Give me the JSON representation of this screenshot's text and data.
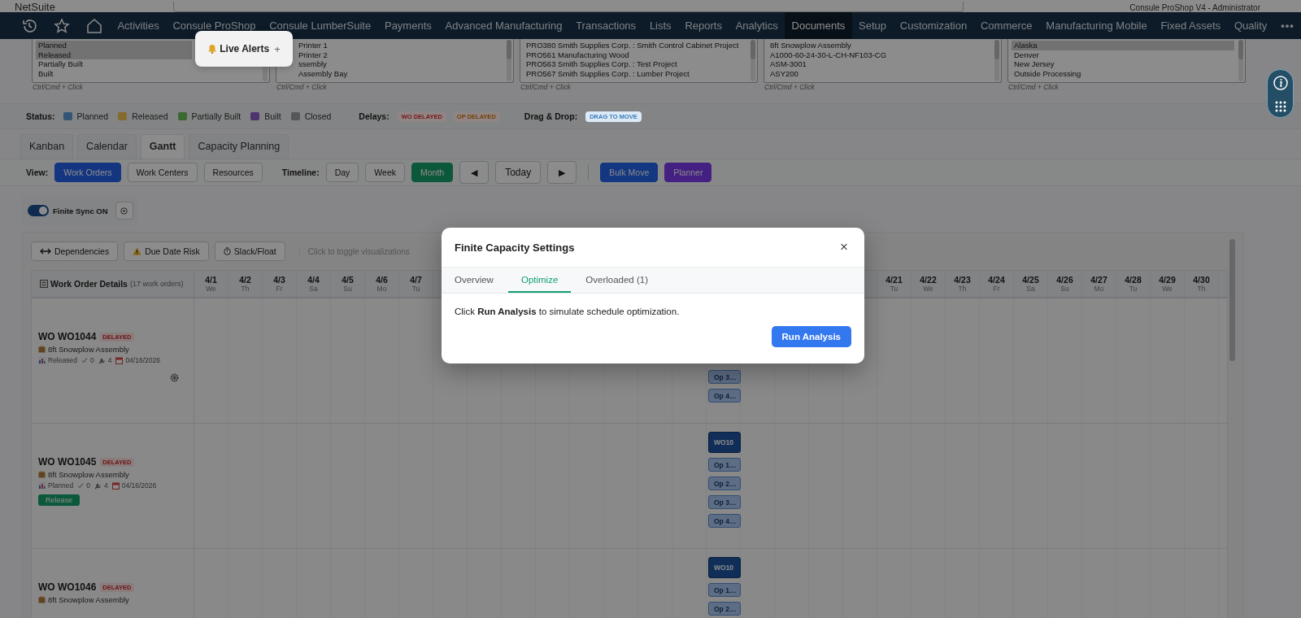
{
  "app": {
    "logo": "NetSuite",
    "user": "Consule ProShop V4 - Administrator"
  },
  "nav": {
    "items": [
      {
        "label": "Activities",
        "selected": false
      },
      {
        "label": "Consule ProShop",
        "selected": false
      },
      {
        "label": "Consule LumberSuite",
        "selected": false
      },
      {
        "label": "Payments",
        "selected": false
      },
      {
        "label": "Advanced Manufacturing",
        "selected": false
      },
      {
        "label": "Transactions",
        "selected": false
      },
      {
        "label": "Lists",
        "selected": false
      },
      {
        "label": "Reports",
        "selected": false
      },
      {
        "label": "Analytics",
        "selected": false
      },
      {
        "label": "Documents",
        "selected": true
      },
      {
        "label": "Setup",
        "selected": false
      },
      {
        "label": "Customization",
        "selected": false
      },
      {
        "label": "Commerce",
        "selected": false
      },
      {
        "label": "Manufacturing Mobile",
        "selected": false
      },
      {
        "label": "Fixed Assets",
        "selected": false
      },
      {
        "label": "Quality",
        "selected": false
      }
    ],
    "more": "•••"
  },
  "live_alerts": {
    "label": "Live Alerts",
    "plus": "+"
  },
  "filters": [
    {
      "hint": "Ctrl/Cmd + Click",
      "items": [
        {
          "label": "Planned",
          "selected": true
        },
        {
          "label": "Released",
          "selected": true
        },
        {
          "label": "Partially Built",
          "selected": false
        },
        {
          "label": "Built",
          "selected": false
        }
      ]
    },
    {
      "hint": "Ctrl/Cmd + Click",
      "items": [
        {
          "label": "Printer 1",
          "selected": false
        },
        {
          "label": "Printer 2",
          "selected": false
        },
        {
          "label": "ssembly",
          "selected": false
        },
        {
          "label": "Assembly Bay",
          "selected": false
        }
      ]
    },
    {
      "hint": "Ctrl/Cmd + Click",
      "items": [
        {
          "label": "PRO380 Smith Supplies Corp. : Smith Control Cabinet Project",
          "selected": false
        },
        {
          "label": "PRO561 Manufacturing Wood",
          "selected": false
        },
        {
          "label": "PRO563 Smith Supplies Corp. : Test Project",
          "selected": false
        },
        {
          "label": "PRO567 Smith Supplies Corp. : Lumber Project",
          "selected": false
        }
      ]
    },
    {
      "hint": "Ctrl/Cmd + Click",
      "items": [
        {
          "label": "8ft Snowplow Assembly",
          "selected": false
        },
        {
          "label": "A1000-60-24-30-L-CH-NF103-CG",
          "selected": false
        },
        {
          "label": "ASM-3001",
          "selected": false
        },
        {
          "label": "ASY200",
          "selected": false
        }
      ]
    },
    {
      "hint": "Ctrl/Cmd + Click",
      "items": [
        {
          "label": "Alaska",
          "selected": true
        },
        {
          "label": "Denver",
          "selected": false
        },
        {
          "label": "New Jersey",
          "selected": false
        },
        {
          "label": "Outside Processing",
          "selected": false
        }
      ]
    }
  ],
  "legend": {
    "status_label": "Status:",
    "statuses": [
      {
        "label": "Planned",
        "color": "#325575"
      },
      {
        "label": "Released",
        "color": "#846a2c"
      },
      {
        "label": "Partially Built",
        "color": "#3b6932"
      },
      {
        "label": "Built",
        "color": "#4e336f"
      },
      {
        "label": "Closed",
        "color": "#55585b"
      }
    ],
    "delays_label": "Delays:",
    "delays": [
      {
        "label": "WO DELAYED",
        "color": "#791515"
      },
      {
        "label": "OP DELAYED",
        "color": "#774103"
      }
    ],
    "drag_label": "Drag & Drop:",
    "drag_tag": "DRAG TO MOVE"
  },
  "tabs": [
    {
      "label": "Kanban",
      "selected": false
    },
    {
      "label": "Calendar",
      "selected": false
    },
    {
      "label": "Gantt",
      "selected": true
    },
    {
      "label": "Capacity Planning",
      "selected": false
    }
  ],
  "view": {
    "label": "View:",
    "options": [
      {
        "label": "Work Orders",
        "selected": true
      },
      {
        "label": "Work Centers",
        "selected": false
      },
      {
        "label": "Resources",
        "selected": false
      }
    ],
    "timeline_label": "Timeline:",
    "timeline": [
      {
        "label": "Day",
        "selected": false
      },
      {
        "label": "Week",
        "selected": false
      },
      {
        "label": "Month",
        "selected": true
      }
    ],
    "prev": "◀",
    "today": "Today",
    "next": "▶",
    "actions": [
      {
        "label": "Bulk Move",
        "color": "#143781"
      },
      {
        "label": "Planner",
        "color": "#442082"
      }
    ]
  },
  "sync": {
    "label": "Finite Sync ON",
    "on": true
  },
  "gantt": {
    "toggles": [
      {
        "label": "Dependencies",
        "kind": "dependencies"
      },
      {
        "label": "Due Date Risk",
        "kind": "risk"
      },
      {
        "label": "Slack/Float",
        "kind": "slack"
      }
    ],
    "hint": "Click to toggle visualizations",
    "details_title": "Work Order Details",
    "details_count": "(17 work orders)",
    "dates_left": [
      {
        "date": "4/1",
        "day": "We"
      },
      {
        "date": "4/2",
        "day": "Th"
      },
      {
        "date": "4/3",
        "day": "Fr"
      },
      {
        "date": "4/4",
        "day": "Sa"
      },
      {
        "date": "4/5",
        "day": "Su"
      },
      {
        "date": "4/6",
        "day": "Mo"
      },
      {
        "date": "4/7",
        "day": "Tu"
      }
    ],
    "dates_right": [
      {
        "date": "4/21",
        "day": "Tu"
      },
      {
        "date": "4/22",
        "day": "We"
      },
      {
        "date": "4/23",
        "day": "Th"
      },
      {
        "date": "4/24",
        "day": "Fr"
      },
      {
        "date": "4/25",
        "day": "Sa"
      },
      {
        "date": "4/26",
        "day": "Su"
      },
      {
        "date": "4/27",
        "day": "Mo"
      },
      {
        "date": "4/28",
        "day": "Tu"
      },
      {
        "date": "4/29",
        "day": "We"
      },
      {
        "date": "4/30",
        "day": "Th"
      }
    ],
    "rows": [
      {
        "wo": "WO WO1044",
        "badge": "DELAYED",
        "product": "8ft Snowplow Assembly",
        "meta": {
          "status": "Released",
          "done": "0",
          "ops": "4",
          "due": "04/16/2026"
        },
        "settings": true,
        "bars": [
          {
            "label": "Op 3…",
            "kind": "op"
          },
          {
            "label": "Op 4…",
            "kind": "op"
          }
        ]
      },
      {
        "wo": "WO WO1045",
        "badge": "DELAYED",
        "product": "8ft Snowplow Assembly",
        "meta": {
          "status": "Planned",
          "done": "0",
          "ops": "4",
          "due": "04/16/2026"
        },
        "settings": false,
        "action": "Release",
        "bars": [
          {
            "label": "WO10",
            "kind": "wo"
          },
          {
            "label": "Op 1…",
            "kind": "op"
          },
          {
            "label": "Op 2…",
            "kind": "op"
          },
          {
            "label": "Op 3…",
            "kind": "op"
          },
          {
            "label": "Op 4…",
            "kind": "op"
          }
        ]
      },
      {
        "wo": "WO WO1046",
        "badge": "DELAYED",
        "product": "8ft Snowplow Assembly",
        "bars": [
          {
            "label": "WO10",
            "kind": "wo"
          },
          {
            "label": "Op 1…",
            "kind": "op"
          },
          {
            "label": "Op 2…",
            "kind": "op"
          }
        ]
      }
    ]
  },
  "modal": {
    "title": "Finite Capacity Settings",
    "close": "×",
    "tabs": [
      {
        "label": "Overview",
        "selected": false
      },
      {
        "label": "Optimize",
        "selected": true
      },
      {
        "label": "Overloaded (1)",
        "selected": false
      }
    ],
    "body": "Click **Run Analysis** to simulate schedule optimization.",
    "button": "Run Analysis"
  }
}
